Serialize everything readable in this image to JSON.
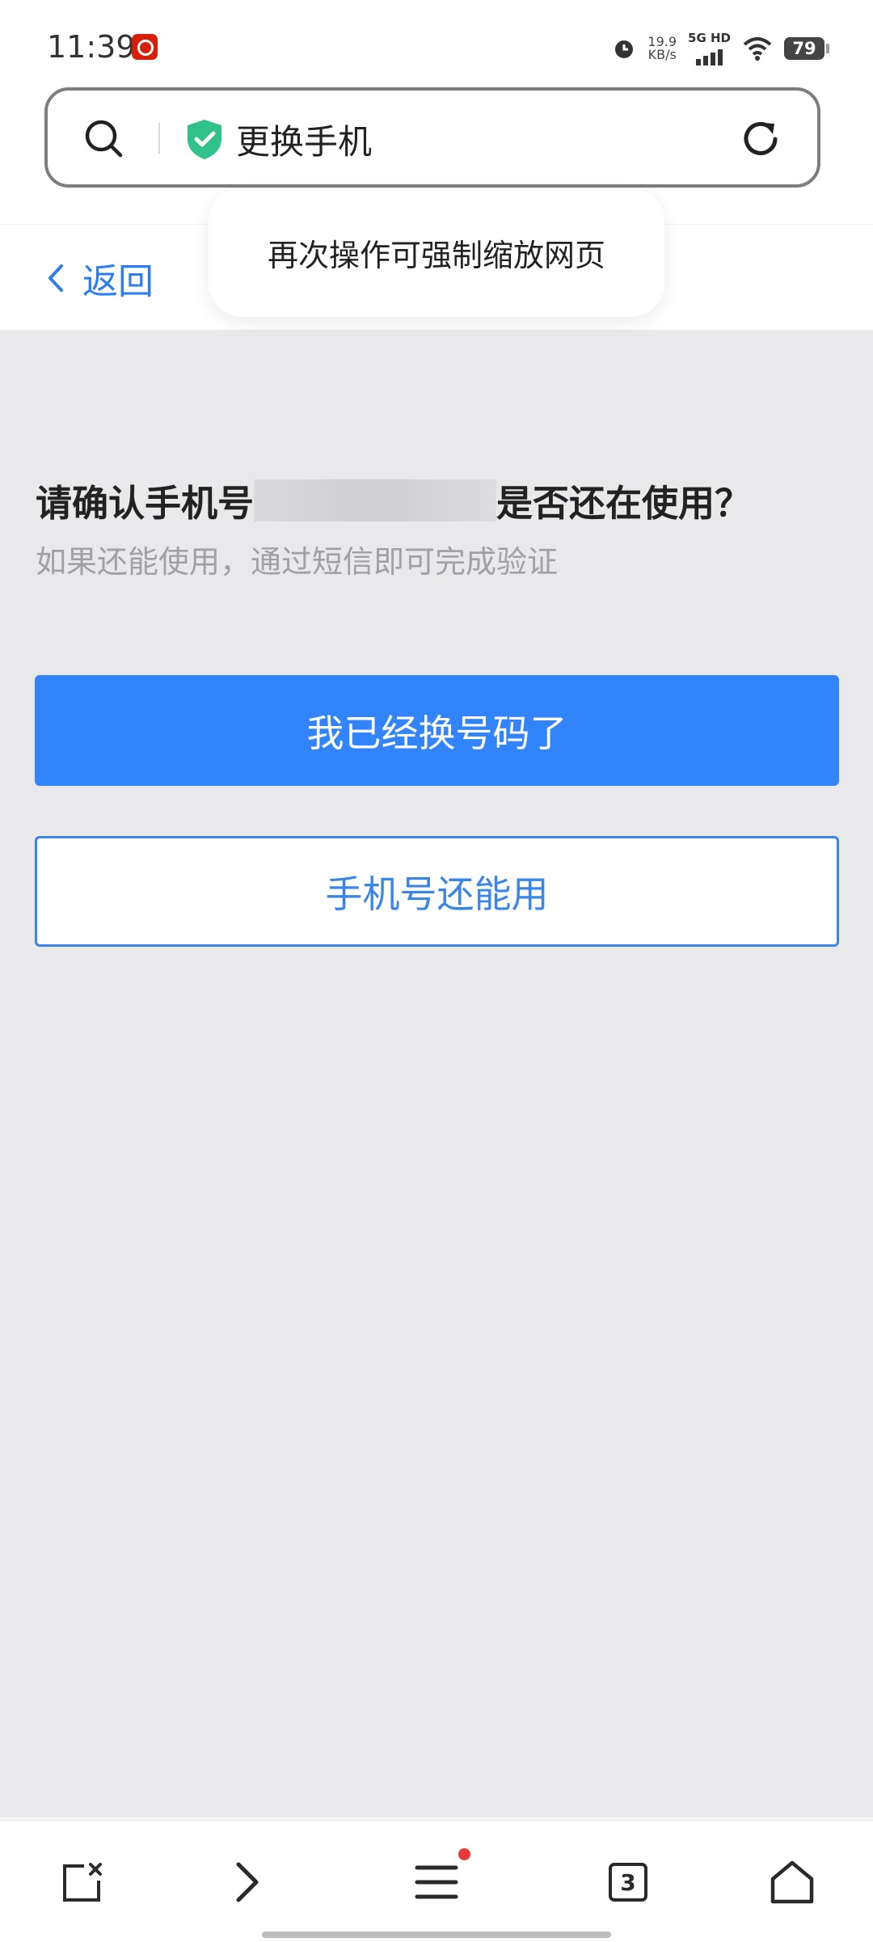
{
  "status_bar": {
    "time": "11:39",
    "speed_value": "19.9",
    "speed_unit": "KB/s",
    "network": "5G HD",
    "battery": "79",
    "icons": [
      "netease-music-icon",
      "alarm-icon",
      "signal-icon",
      "wifi-icon",
      "battery-icon"
    ]
  },
  "url_bar": {
    "title": "更换手机",
    "secure_icon": "shield-check-icon",
    "accent": "#2fc28b"
  },
  "nav": {
    "back_label": "返回"
  },
  "toast": {
    "message": "再次操作可强制缩放网页"
  },
  "content": {
    "question_prefix": "请确认手机号",
    "question_suffix": "是否还在使用？",
    "subtitle": "如果还能使用，通过短信即可完成验证",
    "primary_button": "我已经换号码了",
    "secondary_button": "手机号还能用",
    "primary_color": "#3184fc",
    "background_color": "#e9e9ec"
  },
  "bottom_toolbar": {
    "tab_count": "3",
    "items": [
      "close-tab-icon",
      "forward-icon",
      "menu-icon",
      "tabs-icon",
      "home-icon"
    ]
  }
}
